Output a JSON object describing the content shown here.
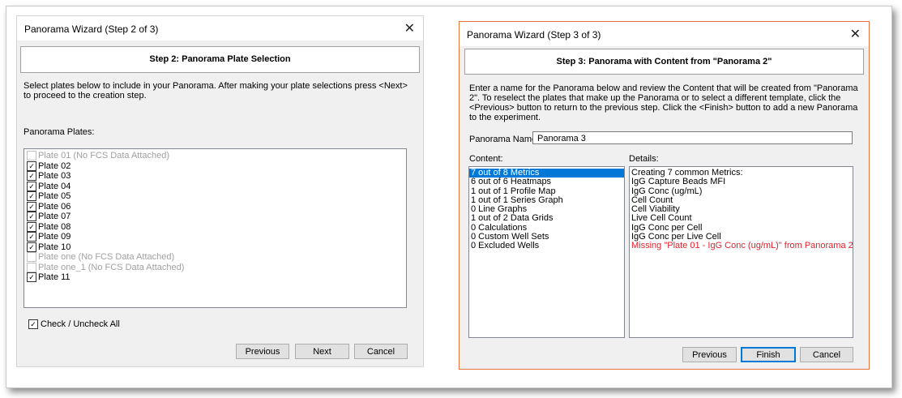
{
  "wizard_step2": {
    "window_title": "Panorama Wizard (Step 2 of 3)",
    "header": "Step 2: Panorama Plate Selection",
    "description": "Select plates below to include in your Panorama. After making your plate selections press <Next> to proceed to the creation step.",
    "plates_label": "Panorama Plates:",
    "plates": [
      {
        "label": "Plate 01 (No FCS Data Attached)",
        "checked": false,
        "enabled": false
      },
      {
        "label": "Plate 02",
        "checked": true,
        "enabled": true
      },
      {
        "label": "Plate 03",
        "checked": true,
        "enabled": true
      },
      {
        "label": "Plate 04",
        "checked": true,
        "enabled": true
      },
      {
        "label": "Plate 05",
        "checked": true,
        "enabled": true
      },
      {
        "label": "Plate 06",
        "checked": true,
        "enabled": true
      },
      {
        "label": "Plate 07",
        "checked": true,
        "enabled": true
      },
      {
        "label": "Plate 08",
        "checked": true,
        "enabled": true
      },
      {
        "label": "Plate 09",
        "checked": true,
        "enabled": true
      },
      {
        "label": "Plate 10",
        "checked": true,
        "enabled": true
      },
      {
        "label": "Plate one (No FCS Data Attached)",
        "checked": false,
        "enabled": false
      },
      {
        "label": "Plate one_1 (No FCS Data Attached)",
        "checked": false,
        "enabled": false
      },
      {
        "label": "Plate 11",
        "checked": true,
        "enabled": true
      }
    ],
    "check_all_label": "Check / Uncheck All",
    "check_all_checked": true,
    "buttons": {
      "previous": "Previous",
      "next": "Next",
      "cancel": "Cancel"
    }
  },
  "wizard_step3": {
    "window_title": "Panorama Wizard (Step 3 of 3)",
    "header": "Step 3: Panorama with Content from \"Panorama 2\"",
    "description": "Enter a name for the Panorama below and review the Content that will be created from \"Panorama 2\". To reselect the plates that make up the Panorama or to select a different template, click the <Previous> button to return to the previous step. Click the <Finish> button to add a new Panorama to the experiment.",
    "name_label": "Panorama Name:",
    "name_value": "Panorama 3",
    "content_label": "Content:",
    "details_label": "Details:",
    "content_items": [
      "7 out of 8 Metrics",
      "6 out of 6 Heatmaps",
      "1 out of 1 Profile Map",
      "1 out of 1 Series Graph",
      "0 Line Graphs",
      "1 out of 2 Data Grids",
      "0 Calculations",
      "0 Custom Well Sets",
      "0 Excluded Wells"
    ],
    "details_items": [
      "Creating 7 common Metrics:",
      "IgG Capture Beads MFI",
      "IgG Conc (ug/mL)",
      "Cell Count",
      "Cell Viability",
      "Live Cell Count",
      "IgG Conc per Cell",
      "IgG Conc per Live Cell"
    ],
    "details_missing": "Missing \"Plate 01 - IgG Conc (ug/mL)\" from Panorama 2",
    "missing_color": "#e8202a",
    "selection_color": "#0078d7",
    "buttons": {
      "previous": "Previous",
      "finish": "Finish",
      "cancel": "Cancel"
    }
  }
}
